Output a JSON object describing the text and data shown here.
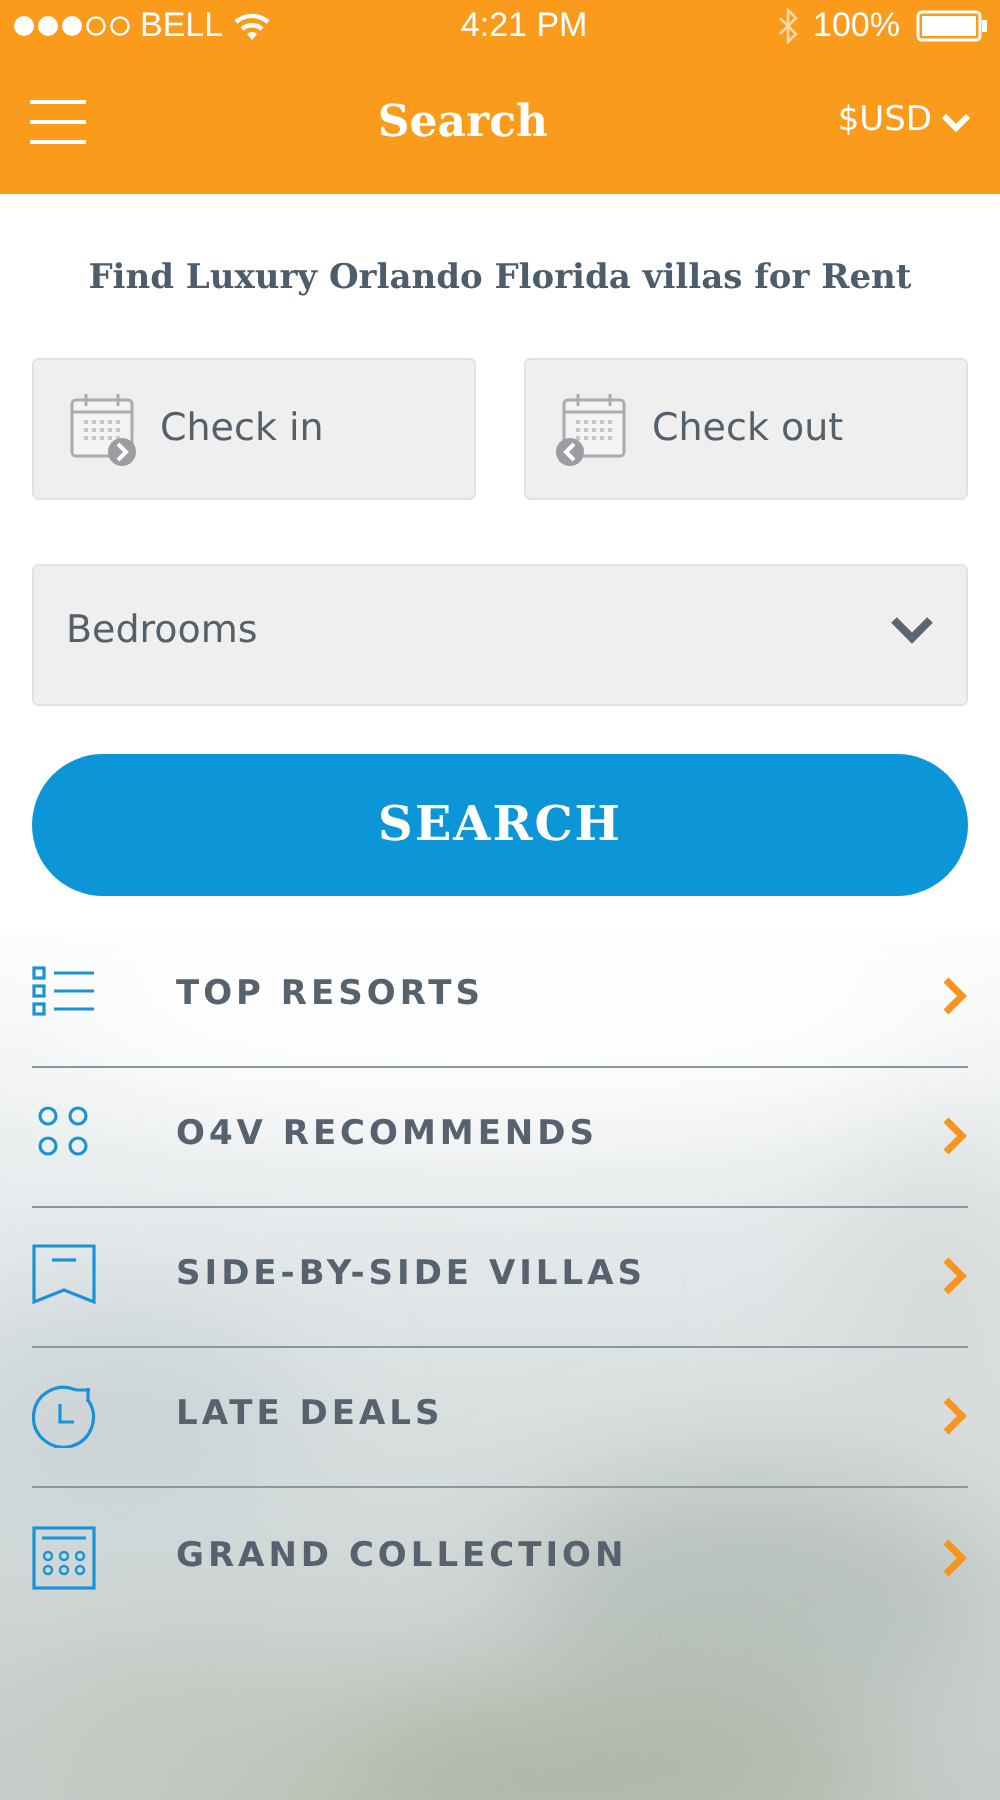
{
  "status_bar": {
    "carrier": "BELL",
    "time": "4:21 PM",
    "battery": "100%"
  },
  "header": {
    "title": "Search",
    "currency": "$USD"
  },
  "heading": "Find Luxury Orlando Florida villas for Rent",
  "dates": [
    {
      "kind": "checkin",
      "placeholder": "Check in"
    },
    {
      "kind": "checkout",
      "placeholder": "Check out"
    }
  ],
  "bedrooms": {
    "placeholder": "Bedrooms"
  },
  "search_button": "SEARCH",
  "menu": [
    {
      "kind": "list",
      "label": "TOP RESORTS"
    },
    {
      "kind": "circles",
      "label": "O4V RECOMMENDS"
    },
    {
      "kind": "bookmark",
      "label": "SIDE-BY-SIDE VILLAS"
    },
    {
      "kind": "clock",
      "label": "LATE DEALS"
    },
    {
      "kind": "calendar",
      "label": "GRAND COLLECTION"
    }
  ]
}
